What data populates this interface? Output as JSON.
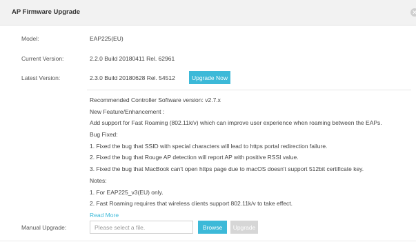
{
  "dialog": {
    "title": "AP Firmware Upgrade",
    "close_icon": "close-icon"
  },
  "info": {
    "model_label": "Model:",
    "model_value": "EAP225(EU)",
    "current_label": "Current Version:",
    "current_value": "2.2.0 Build 20180411 Rel. 62961",
    "latest_label": "Latest Version:",
    "latest_value": "2.3.0 Build 20180628 Rel. 54512",
    "upgrade_now_label": "Upgrade Now"
  },
  "release_notes": [
    "Recommended Controller Software version: v2.7.x",
    "New Feature/Enhancement :",
    "Add support for Fast Roaming (802.11k/v) which can improve user experience when roaming between the EAPs.",
    "Bug Fixed:",
    "1. Fixed the bug that SSID with special characters will lead to https portal redirection failure.",
    "2. Fixed the bug that Rouge AP detection will report AP with positive RSSI value.",
    "3. Fixed the bug that MacBook can't open https page due to macOS doesn't support 512bit certificate key.",
    "Notes:",
    "1. For EAP225_v3(EU) only.",
    "2. Fast Roaming requires that wireless clients support 802.11k/v to take effect."
  ],
  "read_more_label": "Read More",
  "manual": {
    "label": "Manual Upgrade:",
    "placeholder": "Please select a file.",
    "value": "",
    "browse_label": "Browse",
    "upgrade_label": "Upgrade"
  },
  "colors": {
    "accent": "#3cb9d8",
    "header_bg": "#f2f2f2",
    "disabled": "#d6d6d6"
  }
}
